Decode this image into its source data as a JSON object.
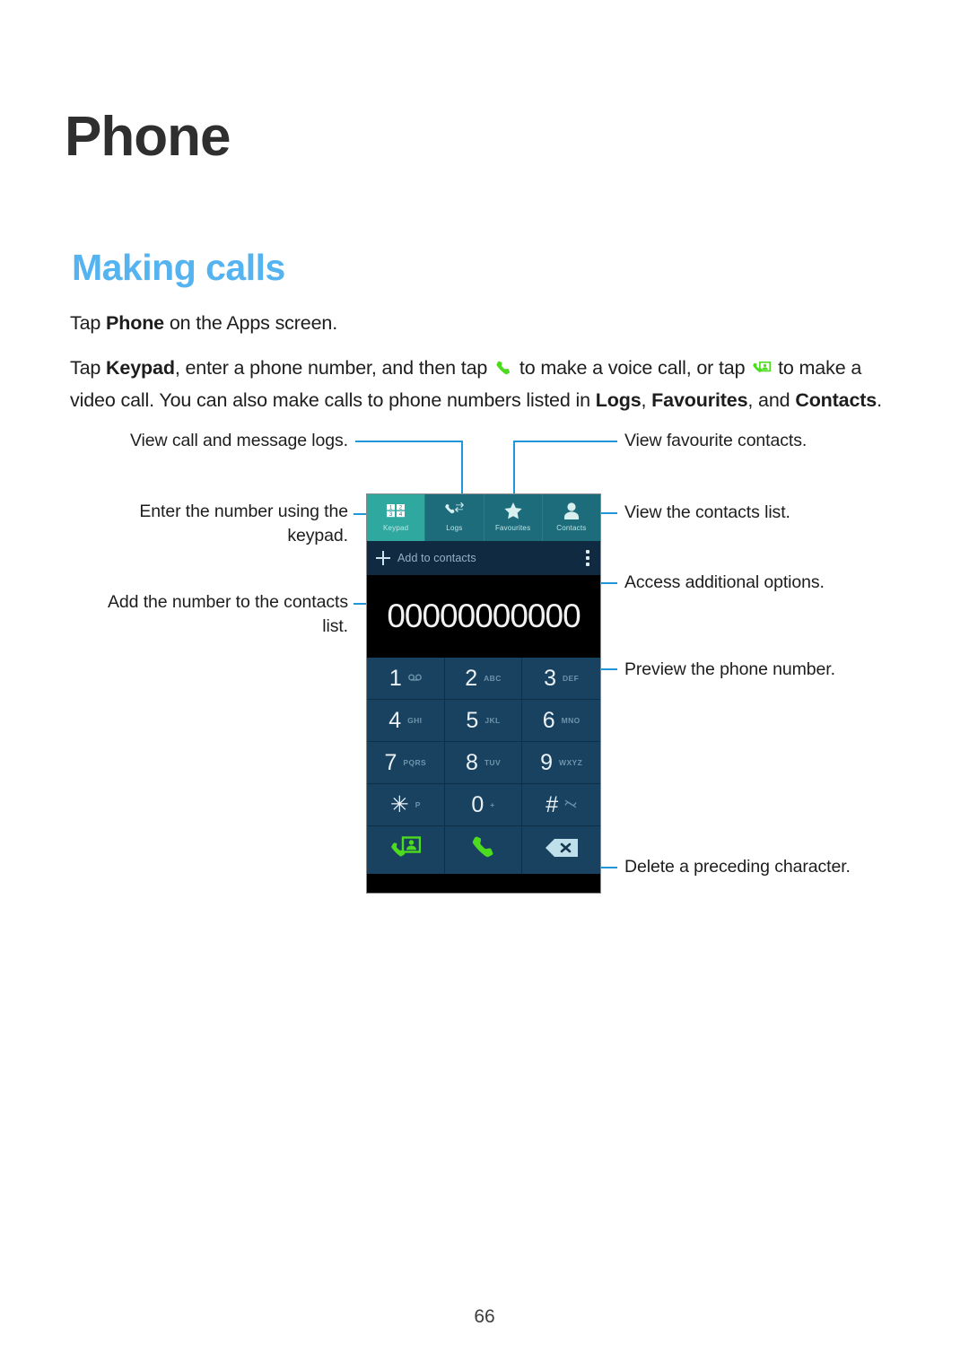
{
  "document": {
    "chapter_title": "Phone",
    "section_title": "Making calls",
    "page_number": "66"
  },
  "body": {
    "paragraph1": {
      "before": "Tap ",
      "bold1": "Phone",
      "after": " on the Apps screen."
    },
    "paragraph2": {
      "t1": "Tap ",
      "bold1": "Keypad",
      "t2": ", enter a phone number, and then tap ",
      "icon1": "voice-call-icon",
      "t3": " to make a voice call, or tap ",
      "icon2": "video-call-icon",
      "t4": " to make a video call. You can also make calls to phone numbers listed in ",
      "bold2": "Logs",
      "t5": ", ",
      "bold3": "Favourites",
      "t6": ", and ",
      "bold4": "Contacts",
      "t7": "."
    }
  },
  "annotations": {
    "logs": "View call and message logs.",
    "keypad": "Enter the number using the\nkeypad.",
    "add_contacts": "Add the number to the contacts\nlist.",
    "favourites": "View favourite contacts.",
    "contacts": "View the contacts list.",
    "more_options": "Access additional options.",
    "preview_number": "Preview the phone number.",
    "delete": "Delete a preceding character."
  },
  "phone_screenshot": {
    "tabs": [
      {
        "label": "Keypad",
        "icon": "keypad-grid-icon",
        "active": true
      },
      {
        "label": "Logs",
        "icon": "call-log-icon",
        "active": false
      },
      {
        "label": "Favourites",
        "icon": "star-icon",
        "active": false
      },
      {
        "label": "Contacts",
        "icon": "person-icon",
        "active": false
      }
    ],
    "add_to_contacts_label": "Add to contacts",
    "phone_number": "00000000000",
    "keys": [
      {
        "digit": "1",
        "sub": "",
        "sub_icon": "voicemail-icon"
      },
      {
        "digit": "2",
        "sub": "ABC",
        "sub_icon": ""
      },
      {
        "digit": "3",
        "sub": "DEF",
        "sub_icon": ""
      },
      {
        "digit": "4",
        "sub": "GHI",
        "sub_icon": ""
      },
      {
        "digit": "5",
        "sub": "JKL",
        "sub_icon": ""
      },
      {
        "digit": "6",
        "sub": "MNO",
        "sub_icon": ""
      },
      {
        "digit": "7",
        "sub": "PQRS",
        "sub_icon": ""
      },
      {
        "digit": "8",
        "sub": "TUV",
        "sub_icon": ""
      },
      {
        "digit": "9",
        "sub": "WXYZ",
        "sub_icon": ""
      },
      {
        "digit": "✳",
        "sub": "P",
        "sub_icon": ""
      },
      {
        "digit": "0",
        "sub": "+",
        "sub_icon": ""
      },
      {
        "digit": "#",
        "sub": "",
        "sub_icon": "mute-wave-icon"
      }
    ],
    "actions": [
      {
        "name": "video-call-button",
        "icon": "video-call-icon"
      },
      {
        "name": "voice-call-button",
        "icon": "voice-call-icon"
      },
      {
        "name": "backspace-button",
        "icon": "backspace-icon"
      }
    ]
  },
  "colors": {
    "section_accent": "#55b3ef",
    "leader_line": "#2196d8",
    "tab_active": "#2fa8a0",
    "tab_inactive": "#1d6c7c",
    "key_bg": "#194260",
    "call_green": "#4ddb1f",
    "addbar_bg": "#102a42"
  }
}
